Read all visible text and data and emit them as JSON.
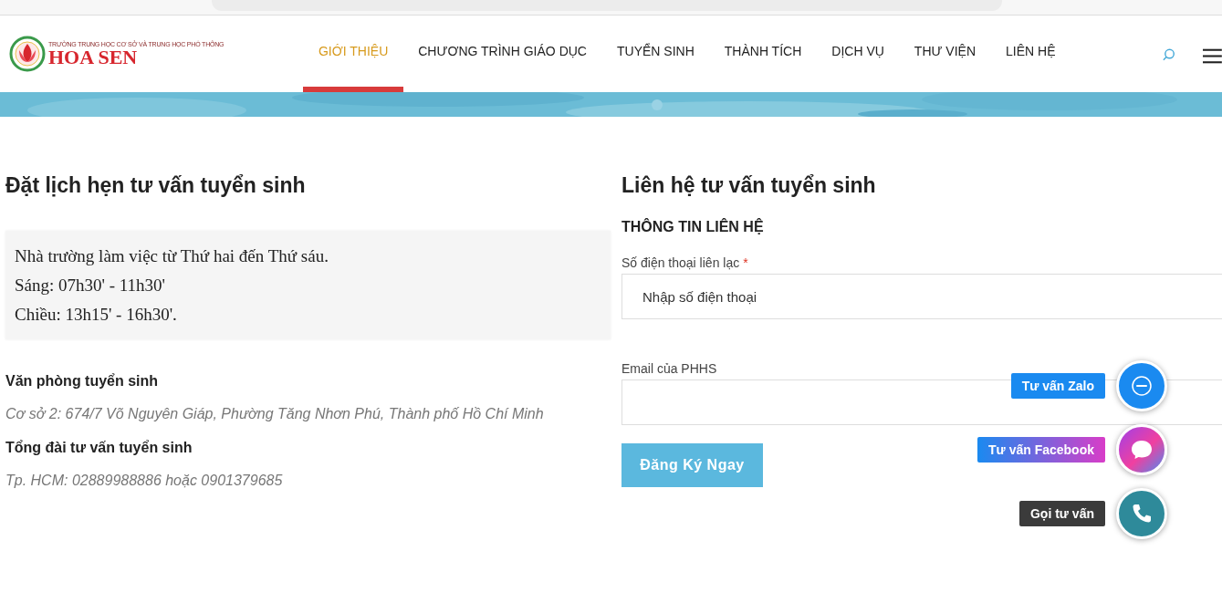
{
  "logo": {
    "subtitle": "TRƯỜNG TRUNG HỌC CƠ SỞ VÀ TRUNG HỌC PHỔ THÔNG",
    "name": "HOA SEN"
  },
  "nav": [
    {
      "label": "GIỚI THIỆU",
      "selected": true
    },
    {
      "label": "CHƯƠNG TRÌNH GIÁO DỤC",
      "selected": false
    },
    {
      "label": "TUYỂN SINH",
      "selected": false
    },
    {
      "label": "THÀNH TÍCH",
      "selected": false
    },
    {
      "label": "DỊCH VỤ",
      "selected": false
    },
    {
      "label": "THƯ VIỆN",
      "selected": false
    },
    {
      "label": "LIÊN HỆ",
      "selected": false
    }
  ],
  "left": {
    "title": "Đặt lịch hẹn tư vấn tuyển sinh",
    "hours": [
      "Nhà trường làm việc từ Thứ hai đến Thứ sáu.",
      "Sáng: 07h30' - 11h30'",
      "Chiều: 13h15' - 16h30'."
    ],
    "sections": [
      {
        "heading": "Văn phòng tuyển sinh",
        "text": "Cơ sở 2:  674/7 Võ Nguyên Giáp, Phường Tăng Nhơn Phú, Thành phố Hồ Chí Minh"
      },
      {
        "heading": "Tổng đài tư vấn tuyển sinh",
        "text": "Tp. HCM: 02889988886 hoặc 0901379685"
      }
    ]
  },
  "form": {
    "title": "Liên hệ tư vấn tuyển sinh",
    "subtitle": "THÔNG TIN LIÊN HỆ",
    "fields": [
      {
        "label": "Số điện thoại liên lạc",
        "required_mark": "*",
        "placeholder": "Nhập số điện thoại"
      },
      {
        "label": "Email của PHHS"
      }
    ],
    "submit": "Đăng Ký Ngay"
  },
  "floating": [
    {
      "kind": "zalo",
      "label": "Tư vấn Zalo"
    },
    {
      "kind": "facebook",
      "label": "Tư vấn Facebook"
    },
    {
      "kind": "phone",
      "label": "Gọi tư vấn"
    }
  ]
}
